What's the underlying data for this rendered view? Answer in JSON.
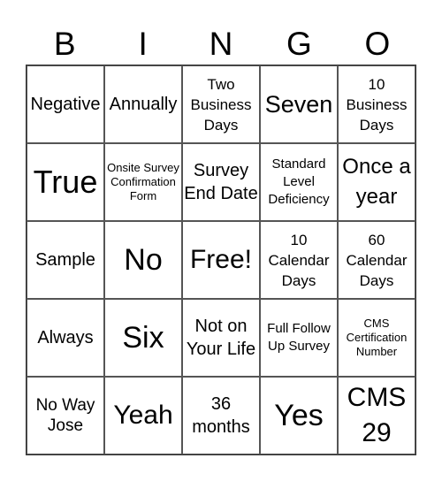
{
  "header": {
    "letters": [
      "B",
      "I",
      "N",
      "G",
      "O"
    ]
  },
  "cells": [
    [
      "Negative",
      "Annually",
      "Two Business Days",
      "Seven",
      "10 Business Days"
    ],
    [
      "True",
      "Onsite Survey Confirmation Form",
      "Survey End Date",
      "Standard Level Deficiency",
      "Once a year"
    ],
    [
      "Sample",
      "No",
      "Free!",
      "10 Calendar Days",
      "60 Calendar Days"
    ],
    [
      "Always",
      "Six",
      "Not on Your Life",
      "Full Follow Up Survey",
      "CMS Certification Number"
    ],
    [
      "No Way Jose",
      "Yeah",
      "36 months",
      "Yes",
      "CMS 29"
    ]
  ]
}
